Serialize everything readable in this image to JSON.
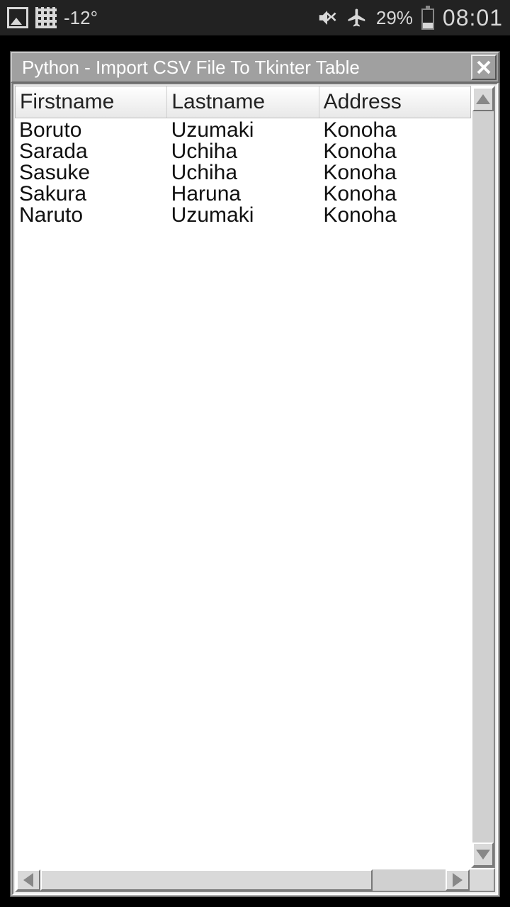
{
  "statusbar": {
    "temperature": "-12°",
    "battery_percent": "29%",
    "time": "08:01"
  },
  "window": {
    "title": "Python - Import CSV File To Tkinter Table"
  },
  "table": {
    "headers": [
      "Firstname",
      "Lastname",
      "Address"
    ],
    "rows": [
      {
        "first": "Boruto",
        "last": "Uzumaki",
        "addr": "Konoha"
      },
      {
        "first": "Sarada",
        "last": "Uchiha",
        "addr": "Konoha"
      },
      {
        "first": "Sasuke",
        "last": "Uchiha",
        "addr": "Konoha"
      },
      {
        "first": "Sakura",
        "last": "Haruna",
        "addr": "Konoha"
      },
      {
        "first": "Naruto",
        "last": "Uzumaki",
        "addr": "Konoha"
      }
    ]
  }
}
